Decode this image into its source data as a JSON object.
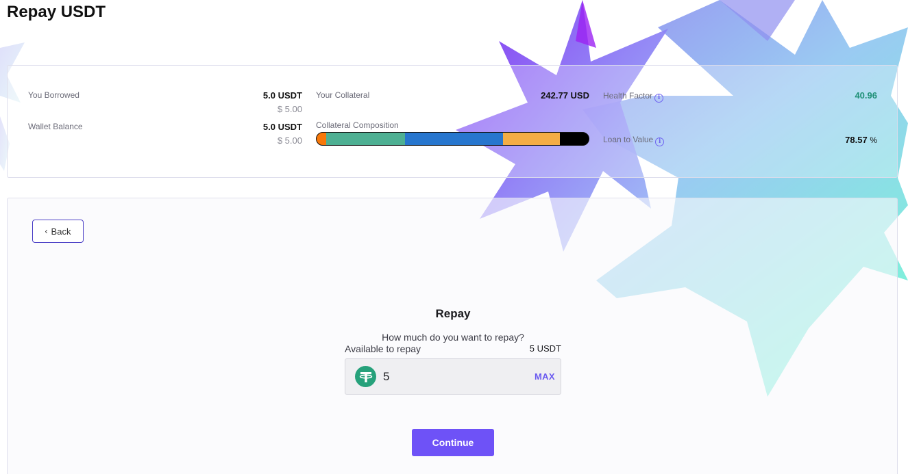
{
  "page": {
    "title": "Repay USDT"
  },
  "stats": {
    "you_borrowed": {
      "label": "You Borrowed",
      "value": "5.0 USDT",
      "usd": "$ 5.00"
    },
    "wallet_balance": {
      "label": "Wallet Balance",
      "value": "5.0 USDT",
      "usd": "$ 5.00"
    },
    "your_collateral": {
      "label": "Your Collateral",
      "value": "242.77 USD"
    },
    "collateral_composition": {
      "label": "Collateral Composition",
      "segments": [
        {
          "color": "#f7780a",
          "fraction": 0.035
        },
        {
          "color": "#4eb093",
          "fraction": 0.29
        },
        {
          "color": "#2776ce",
          "fraction": 0.36
        },
        {
          "color": "#f4ad45",
          "fraction": 0.21
        },
        {
          "color": "#000000",
          "fraction": 0.105
        }
      ]
    },
    "health_factor": {
      "label": "Health Factor",
      "value": "40.96",
      "color": "#1f9077",
      "icon": "info-icon"
    },
    "loan_to_value": {
      "label": "Loan to Value",
      "value": "78.57",
      "unit": "%",
      "icon": "info-icon"
    }
  },
  "repay": {
    "back_label": "Back",
    "title": "Repay",
    "question": "How much do you want to repay?",
    "available_label": "Available to repay",
    "available_value": "5 USDT",
    "amount_value": "5",
    "token_icon": "tether-icon",
    "max_label": "MAX",
    "continue_label": "Continue"
  },
  "colors": {
    "accent": "#6e52f7",
    "health_good": "#1f9077"
  }
}
